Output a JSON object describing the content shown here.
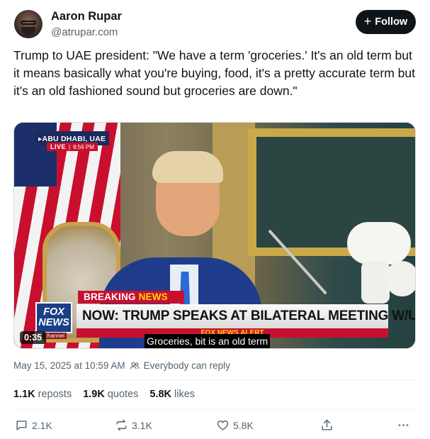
{
  "author": {
    "name": "Aaron Rupar",
    "handle": "@atrupar.com",
    "follow_label": "Follow"
  },
  "post": {
    "text": "Trump to UAE president: \"We have a term 'groceries.' It's an old term but it means basically what you're buying, food, it's a pretty accurate term but it's an old fashioned sound but groceries are down.\""
  },
  "video": {
    "location": "ABU DHABI, UAE",
    "live_label": "LIVE",
    "time": "8:56 PM",
    "breaking_label": "BREAKING",
    "news_label": "NEWS",
    "headline": "NOW: TRUMP SPEAKS AT BILATERAL MEETING W/UAE PRES",
    "alert_text": "FOX NEWS ALERT",
    "logo_line1": "FOX",
    "logo_line2": "NEWS",
    "channel_label": "channel",
    "duration": "0:35",
    "caption": "Groceries, bit is an old term"
  },
  "meta": {
    "date": "May 15, 2025 at 10:59 AM",
    "reply_setting": "Everybody can reply"
  },
  "stats": {
    "reposts_count": "1.1K",
    "reposts_label": "reposts",
    "quotes_count": "1.9K",
    "quotes_label": "quotes",
    "likes_count": "5.8K",
    "likes_label": "likes"
  },
  "actions": {
    "reply_count": "2.1K",
    "repost_count": "3.1K",
    "like_count": "5.8K"
  },
  "colors": {
    "text_primary": "#0f1419",
    "text_secondary": "#536471",
    "follow_bg": "#0f1419",
    "fox_red": "#c8102e",
    "fox_blue": "#1b3f86"
  }
}
